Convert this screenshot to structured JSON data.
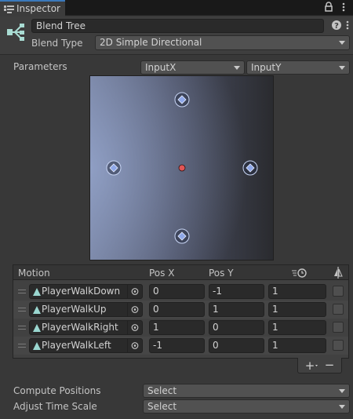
{
  "window": {
    "tab_title": "Inspector"
  },
  "header": {
    "name": "Blend Tree",
    "blend_type_label": "Blend Type",
    "blend_type_value": "2D Simple Directional"
  },
  "parameters": {
    "label": "Parameters",
    "x_param": "InputX",
    "y_param": "InputY"
  },
  "motion_list": {
    "columns": {
      "motion": "Motion",
      "pos_x": "Pos X",
      "pos_y": "Pos Y"
    },
    "rows": [
      {
        "clip": "PlayerWalkDown",
        "pos_x": "0",
        "pos_y": "-1",
        "speed": "1"
      },
      {
        "clip": "PlayerWalkUp",
        "pos_x": "0",
        "pos_y": "1",
        "speed": "1"
      },
      {
        "clip": "PlayerWalkRight",
        "pos_x": "1",
        "pos_y": "0",
        "speed": "1"
      },
      {
        "clip": "PlayerWalkLeft",
        "pos_x": "-1",
        "pos_y": "0",
        "speed": "1"
      }
    ],
    "add_label": "+",
    "remove_label": "−"
  },
  "footer": {
    "compute_positions_label": "Compute Positions",
    "compute_positions_value": "Select",
    "adjust_time_scale_label": "Adjust Time Scale",
    "adjust_time_scale_value": "Select"
  },
  "colors": {
    "accent": "#3a79bb",
    "motion_point": "#8fa8e8",
    "current_point": "#e05555"
  }
}
